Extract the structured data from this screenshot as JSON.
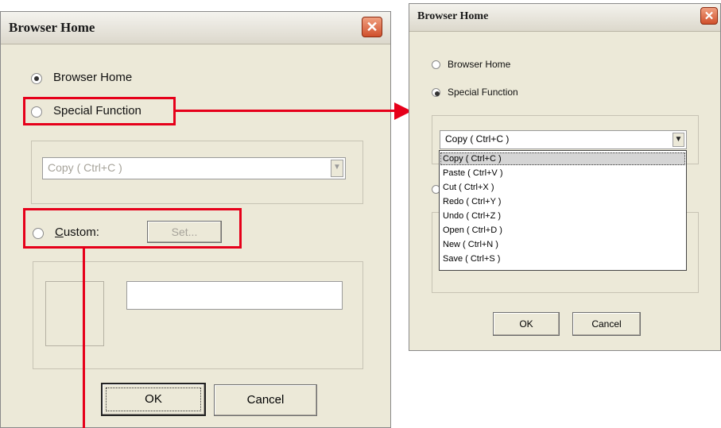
{
  "left_dialog": {
    "title": "Browser Home",
    "close_glyph": "✕",
    "radio_browser_home": "Browser Home",
    "radio_special_function": "Special Function",
    "combo_value": "Copy ( Ctrl+C )",
    "radio_custom_prefix": "C",
    "radio_custom_rest": "ustom:",
    "set_button": "Set...",
    "ok_button": "OK",
    "cancel_button": "Cancel",
    "selected_radio": "Browser Home"
  },
  "right_dialog": {
    "title": "Browser Home",
    "close_glyph": "✕",
    "radio_browser_home": "Browser Home",
    "radio_special_function": "Special Function",
    "combo_value": "Copy ( Ctrl+C )",
    "options": [
      "Copy ( Ctrl+C )",
      "Paste ( Ctrl+V )",
      "Cut ( Ctrl+X )",
      "Redo ( Ctrl+Y )",
      "Undo ( Ctrl+Z )",
      "Open ( Ctrl+D )",
      "New ( Ctrl+N )",
      "Save ( Ctrl+S )"
    ],
    "selected_option": "Copy ( Ctrl+C )",
    "ok_button": "OK",
    "cancel_button": "Cancel",
    "selected_radio": "Special Function"
  },
  "colors": {
    "annotation_red": "#e6001a",
    "dialog_bg": "#ece9d8",
    "close_button": "#d0502c"
  }
}
